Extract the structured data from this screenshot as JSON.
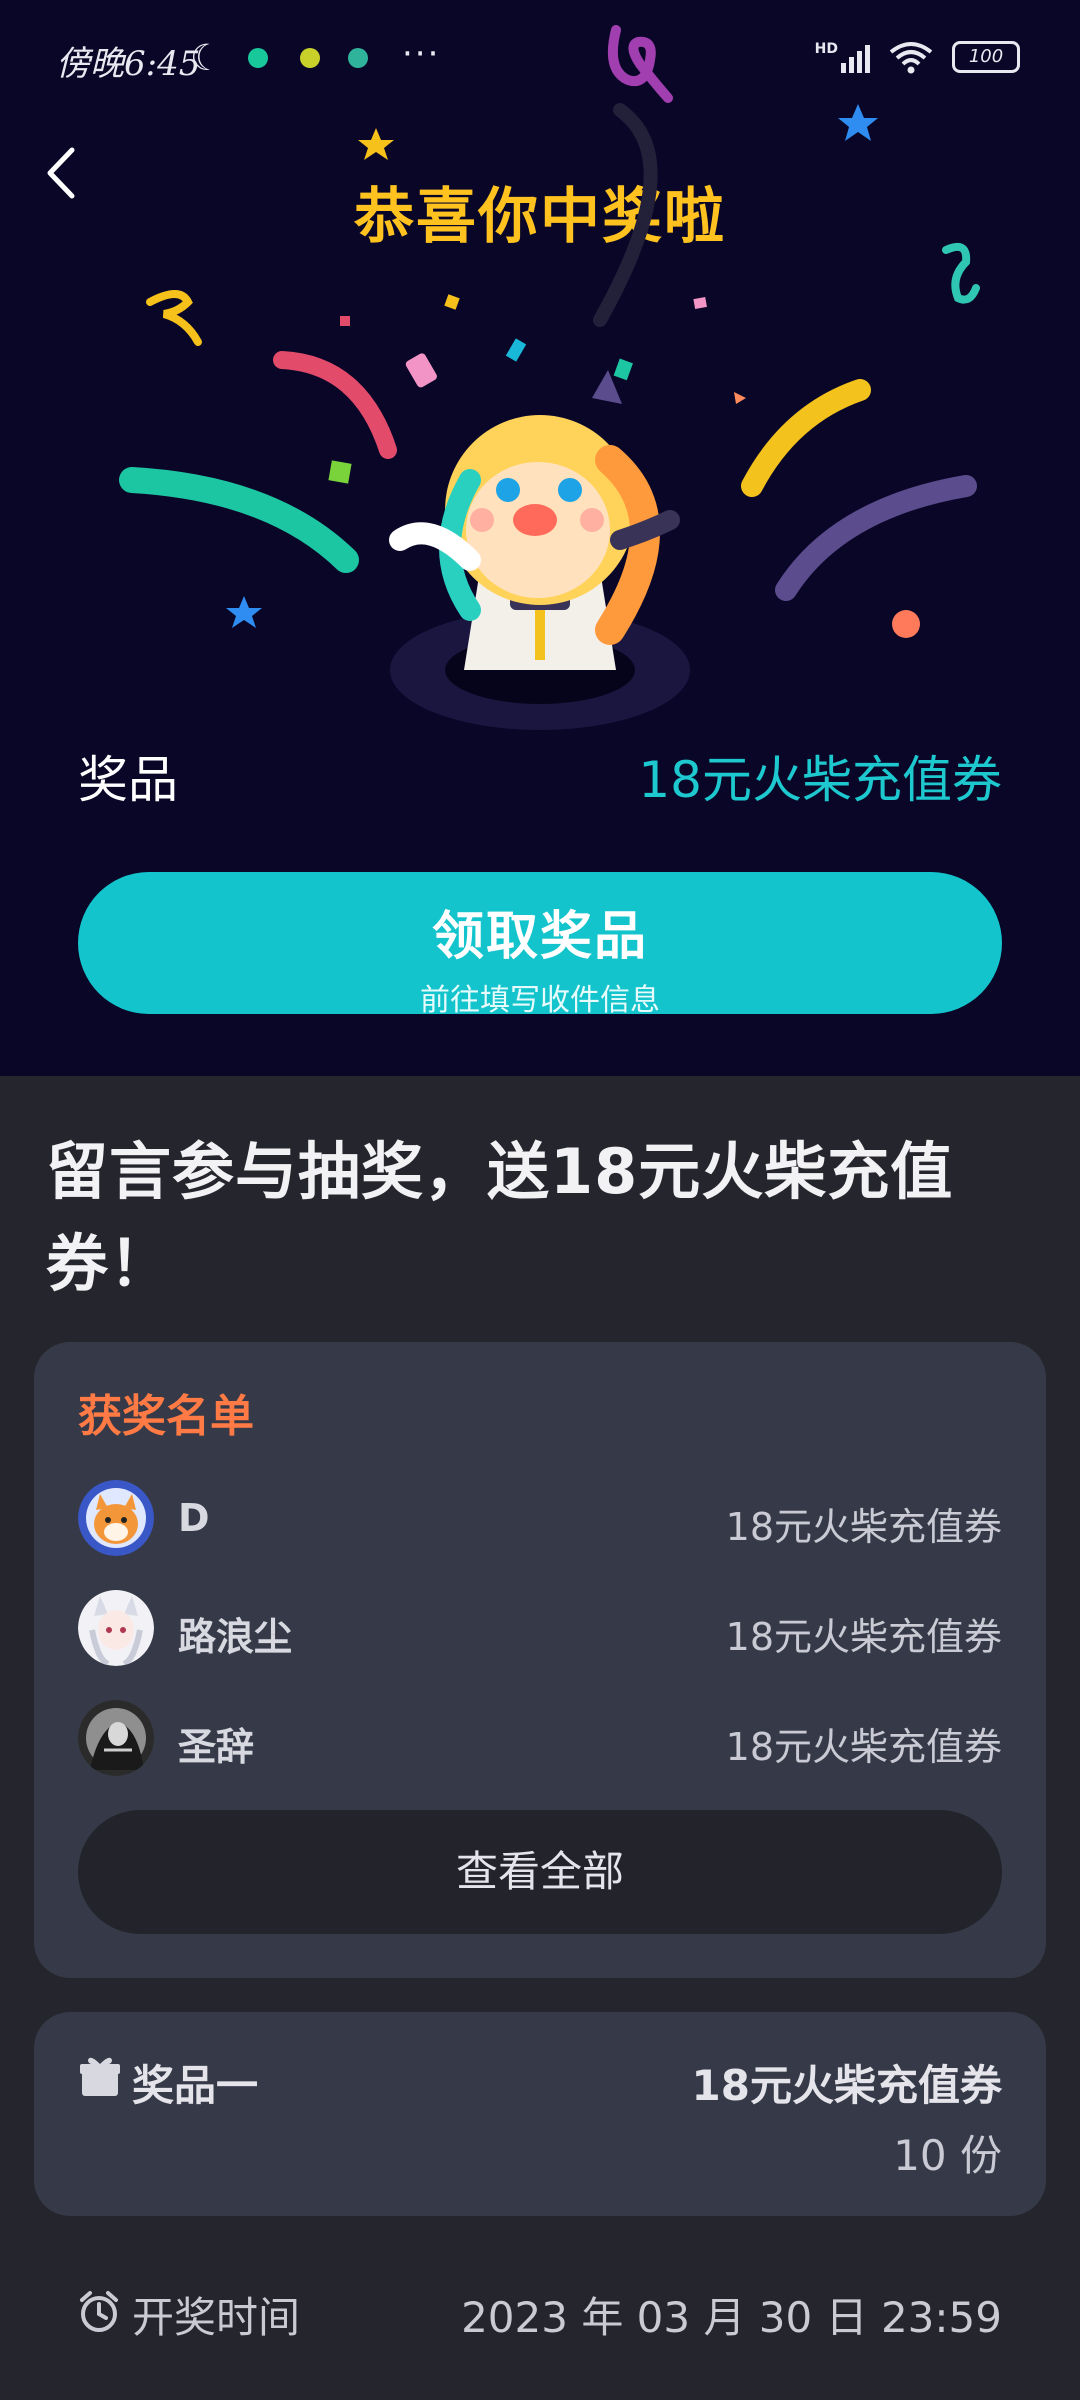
{
  "status_bar": {
    "time": "傍晚6:45",
    "network": "HD",
    "battery": "100"
  },
  "hero": {
    "title": "恭喜你中奖啦",
    "prize_label": "奖品",
    "prize_value": "18元火柴充值券",
    "claim_button": {
      "title": "领取奖品",
      "subtitle": "前往填写收件信息"
    }
  },
  "post": {
    "title": "留言参与抽奖，送18元火柴充值券！"
  },
  "winners": {
    "title": "获奖名单",
    "items": [
      {
        "name": "D",
        "prize": "18元火柴充值券"
      },
      {
        "name": "路浪尘",
        "prize": "18元火柴充值券"
      },
      {
        "name": "圣辞",
        "prize": "18元火柴充值券"
      }
    ],
    "view_all": "查看全部"
  },
  "prize_card": {
    "name": "奖品一",
    "value": "18元火柴充值券",
    "quantity": "10 份"
  },
  "draw": {
    "label": "开奖时间",
    "value": "2023 年 03 月 30 日 23:59"
  },
  "colors": {
    "hero_bg": "#0a0628",
    "title_gold": "#ffc21f",
    "accent_teal": "#14c4cc",
    "winners_orange": "#ff7a44",
    "card_bg": "#363a48",
    "page_bg": "#25262d"
  }
}
